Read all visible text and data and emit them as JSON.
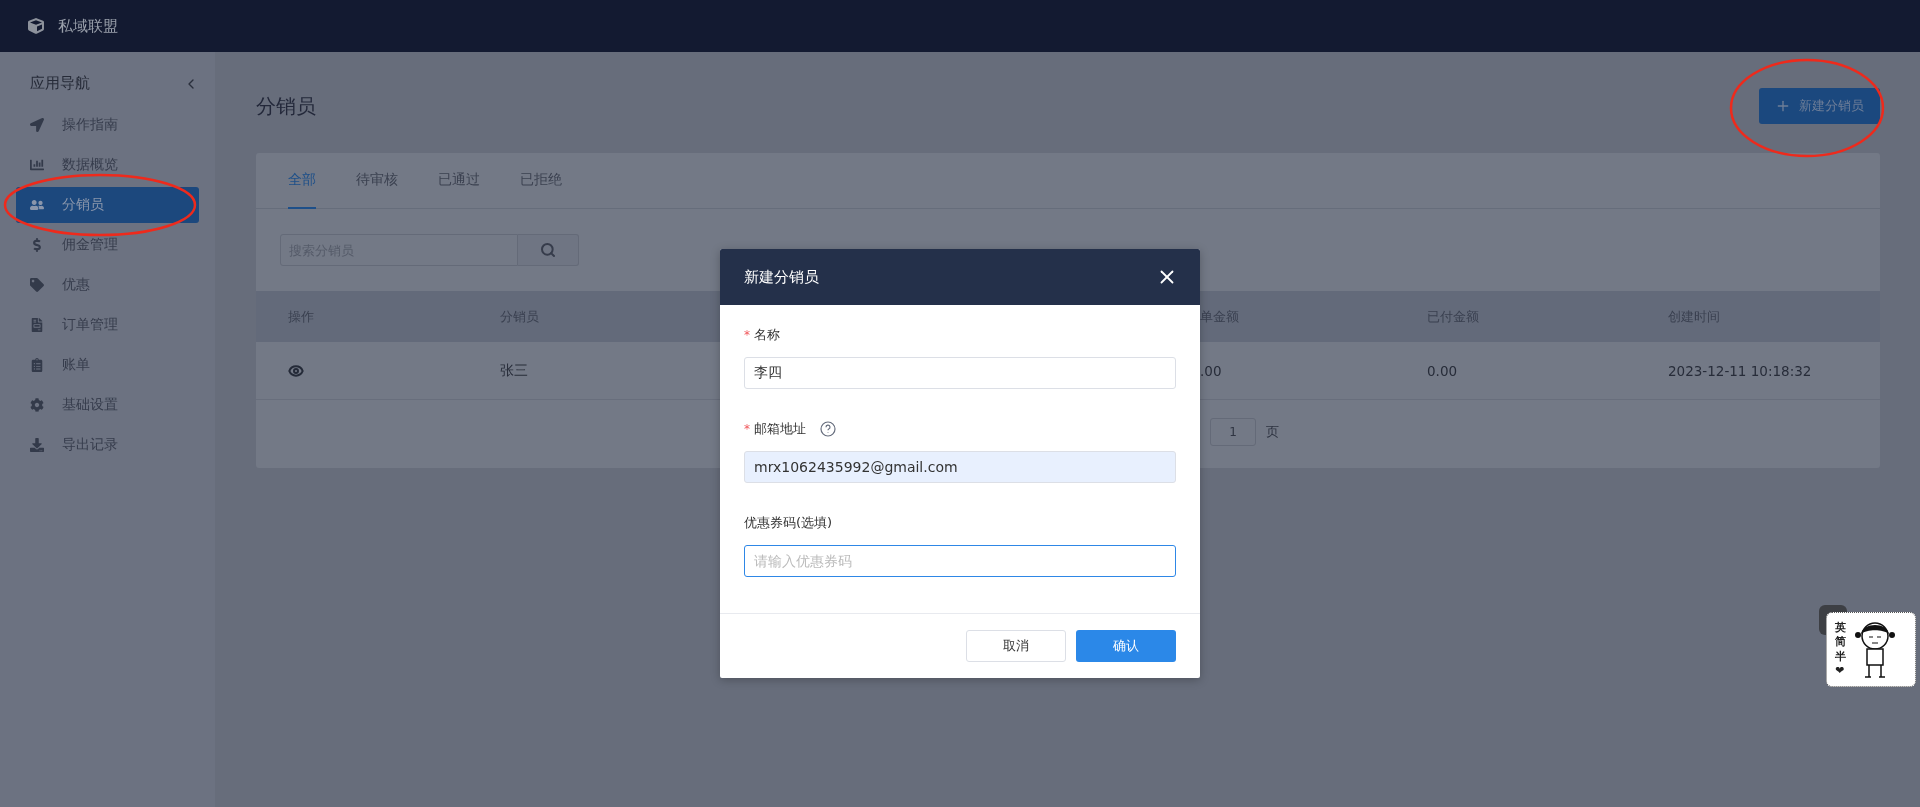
{
  "app": {
    "name": "私域联盟"
  },
  "sidebar": {
    "title": "应用导航",
    "items": [
      {
        "label": "操作指南",
        "selected": false
      },
      {
        "label": "数据概览",
        "selected": false
      },
      {
        "label": "分销员",
        "selected": true
      },
      {
        "label": "佣金管理",
        "selected": false
      },
      {
        "label": "优惠",
        "selected": false
      },
      {
        "label": "订单管理",
        "selected": false
      },
      {
        "label": "账单",
        "selected": false
      },
      {
        "label": "基础设置",
        "selected": false
      },
      {
        "label": "导出记录",
        "selected": false
      }
    ]
  },
  "page": {
    "title": "分销员",
    "new_button": "新建分销员"
  },
  "tabs": [
    {
      "label": "全部",
      "selected": true
    },
    {
      "label": "待审核",
      "selected": false
    },
    {
      "label": "已通过",
      "selected": false
    },
    {
      "label": "已拒绝",
      "selected": false
    }
  ],
  "search": {
    "placeholder": "搜索分销员"
  },
  "table": {
    "columns": [
      "操作",
      "分销员",
      "单金额",
      "已付金额",
      "创建时间"
    ],
    "rows": [
      {
        "name": "张三",
        "order_amount": ".00",
        "paid_amount": "0.00",
        "created": "2023-12-11 10:18:32"
      }
    ]
  },
  "pagination": {
    "page": "1",
    "suffix": "页"
  },
  "dialog": {
    "title": "新建分销员",
    "fields": [
      {
        "label": "名称",
        "required": true,
        "help": false,
        "value": "李四",
        "autofilled": false,
        "focused": false
      },
      {
        "label": "邮箱地址",
        "required": true,
        "help": true,
        "value": "mrx1062435992@gmail.com",
        "autofilled": true,
        "focused": false
      },
      {
        "label": "优惠券码(选填)",
        "required": false,
        "help": false,
        "placeholder": "请输入优惠券码",
        "autofilled": false,
        "focused": true
      }
    ],
    "required_mark": "*",
    "cancel": "取消",
    "confirm": "确认"
  },
  "ime": {
    "chars": [
      "英",
      "简",
      "半",
      "❤"
    ]
  }
}
